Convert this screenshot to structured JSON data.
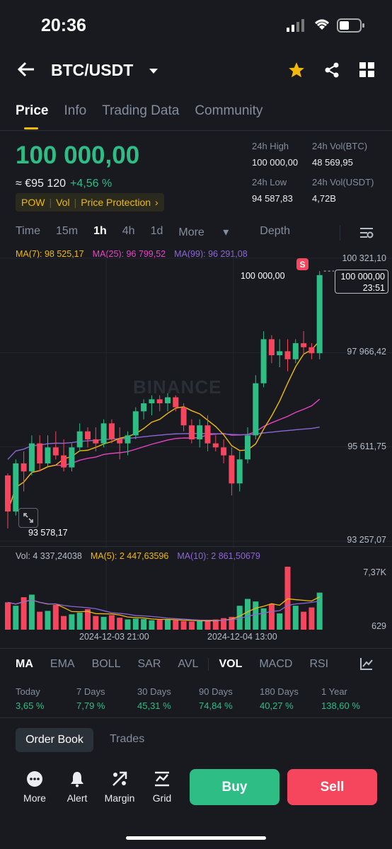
{
  "status": {
    "time": "20:36"
  },
  "header": {
    "pair": "BTC/USDT"
  },
  "tabs": [
    "Price",
    "Info",
    "Trading Data",
    "Community"
  ],
  "price": {
    "last": "100 000,00",
    "approx": "≈ €95 120",
    "change_pct": "+4,56 %",
    "tags": [
      "POW",
      "Vol",
      "Price Protection"
    ]
  },
  "stats": {
    "high_label": "24h High",
    "high_value": "100 000,00",
    "volbtc_label": "24h Vol(BTC)",
    "volbtc_value": "48 569,95",
    "low_label": "24h Low",
    "low_value": "94 587,83",
    "volusdt_label": "24h Vol(USDT)",
    "volusdt_value": "4,72B"
  },
  "intervals": [
    "Time",
    "15m",
    "1h",
    "4h",
    "1d",
    "More",
    "Depth"
  ],
  "ma": {
    "ma7": "MA(7): 98 525,17",
    "ma25": "MA(25): 96 799,52",
    "ma99": "MA(99): 96 291,08"
  },
  "price_axis": [
    "100 321,10",
    "97 966,42",
    "95 611,75",
    "93 257,07"
  ],
  "current_price_tag": {
    "price": "100 000,00",
    "countdown": "23:51"
  },
  "high_marker": "100 000,00",
  "low_marker": "93 578,17",
  "sell_marker": "S",
  "watermark": "BINANCE",
  "volume": {
    "vol": "Vol: 4 337,24038",
    "ma5": "MA(5): 2 447,63596",
    "ma10": "MA(10): 2 861,50679",
    "axis_top": "7,37K",
    "axis_bottom": "629"
  },
  "time_axis": [
    "2024-12-03 21:00",
    "2024-12-04 13:00"
  ],
  "indicators": [
    "MA",
    "EMA",
    "BOLL",
    "SAR",
    "AVL",
    "VOL",
    "MACD",
    "RSI"
  ],
  "performance": [
    {
      "label": "Today",
      "value": "3,65 %"
    },
    {
      "label": "7 Days",
      "value": "7,79 %"
    },
    {
      "label": "30 Days",
      "value": "45,31 %"
    },
    {
      "label": "90 Days",
      "value": "74,84 %"
    },
    {
      "label": "180 Days",
      "value": "40,27 %"
    },
    {
      "label": "1 Year",
      "value": "138,60 %"
    }
  ],
  "book_tabs": [
    "Order Book",
    "Trades"
  ],
  "bottom": {
    "more": "More",
    "alert": "Alert",
    "margin": "Margin",
    "grid": "Grid",
    "buy": "Buy",
    "sell": "Sell"
  },
  "colors": {
    "up": "#2ebd85",
    "down": "#f6465d",
    "accent": "#f0b90b",
    "bg": "#181a20"
  },
  "chart_data": {
    "type": "candlestick",
    "interval": "1h",
    "y_range": [
      93257.07,
      100321.1
    ],
    "candles": [
      [
        94900,
        94950,
        93578,
        94000
      ],
      [
        94000,
        95300,
        93900,
        95200
      ],
      [
        95200,
        95500,
        94500,
        95000
      ],
      [
        95000,
        95900,
        94900,
        95700
      ],
      [
        95700,
        95900,
        95000,
        95200
      ],
      [
        95200,
        95900,
        95100,
        95600
      ],
      [
        95600,
        96000,
        95300,
        95400
      ],
      [
        95400,
        95800,
        95000,
        95100
      ],
      [
        95100,
        95700,
        95000,
        95600
      ],
      [
        95600,
        96200,
        95500,
        96000
      ],
      [
        96000,
        96100,
        95600,
        95800
      ],
      [
        95800,
        96100,
        95500,
        95700
      ],
      [
        95700,
        96300,
        95600,
        96200
      ],
      [
        96200,
        96300,
        95700,
        95800
      ],
      [
        95800,
        96100,
        95300,
        95700
      ],
      [
        95700,
        96000,
        95400,
        95900
      ],
      [
        95900,
        96600,
        95800,
        96500
      ],
      [
        96500,
        96800,
        96300,
        96700
      ],
      [
        96700,
        96900,
        96400,
        96800
      ],
      [
        96800,
        96900,
        96500,
        96700
      ],
      [
        96700,
        96950,
        96500,
        96850
      ],
      [
        96850,
        96900,
        96500,
        96600
      ],
      [
        96600,
        96700,
        96000,
        96150
      ],
      [
        96150,
        96300,
        95700,
        95800
      ],
      [
        95800,
        96300,
        95600,
        96150
      ],
      [
        96150,
        96400,
        95500,
        95700
      ],
      [
        95700,
        95900,
        95500,
        95600
      ],
      [
        95600,
        95800,
        95200,
        95400
      ],
      [
        95400,
        95600,
        94400,
        94700
      ],
      [
        94700,
        95500,
        94500,
        95300
      ],
      [
        95300,
        96100,
        95200,
        95900
      ],
      [
        95900,
        97400,
        95800,
        97200
      ],
      [
        97200,
        98500,
        97100,
        98300
      ],
      [
        98300,
        98400,
        97700,
        97900
      ],
      [
        97900,
        98300,
        97600,
        98000
      ],
      [
        98000,
        98300,
        97500,
        97800
      ],
      [
        97800,
        98300,
        97700,
        98200
      ],
      [
        98200,
        98500,
        97900,
        98100
      ],
      [
        98100,
        98200,
        97800,
        97950
      ],
      [
        97950,
        100000,
        97800,
        99900
      ]
    ],
    "volume": [
      3200,
      2800,
      3800,
      4100,
      2100,
      2200,
      2900,
      1600,
      1800,
      2000,
      2400,
      1600,
      1500,
      1700,
      1400,
      1200,
      1300,
      1250,
      1100,
      1150,
      1200,
      1100,
      1000,
      950,
      1000,
      1100,
      1200,
      1350,
      1500,
      2800,
      3600,
      3300,
      2500,
      3000,
      1900,
      7370,
      2800,
      2100,
      2600,
      4337
    ],
    "ma_lines": [
      "MA(7)",
      "MA(25)",
      "MA(99)"
    ]
  }
}
